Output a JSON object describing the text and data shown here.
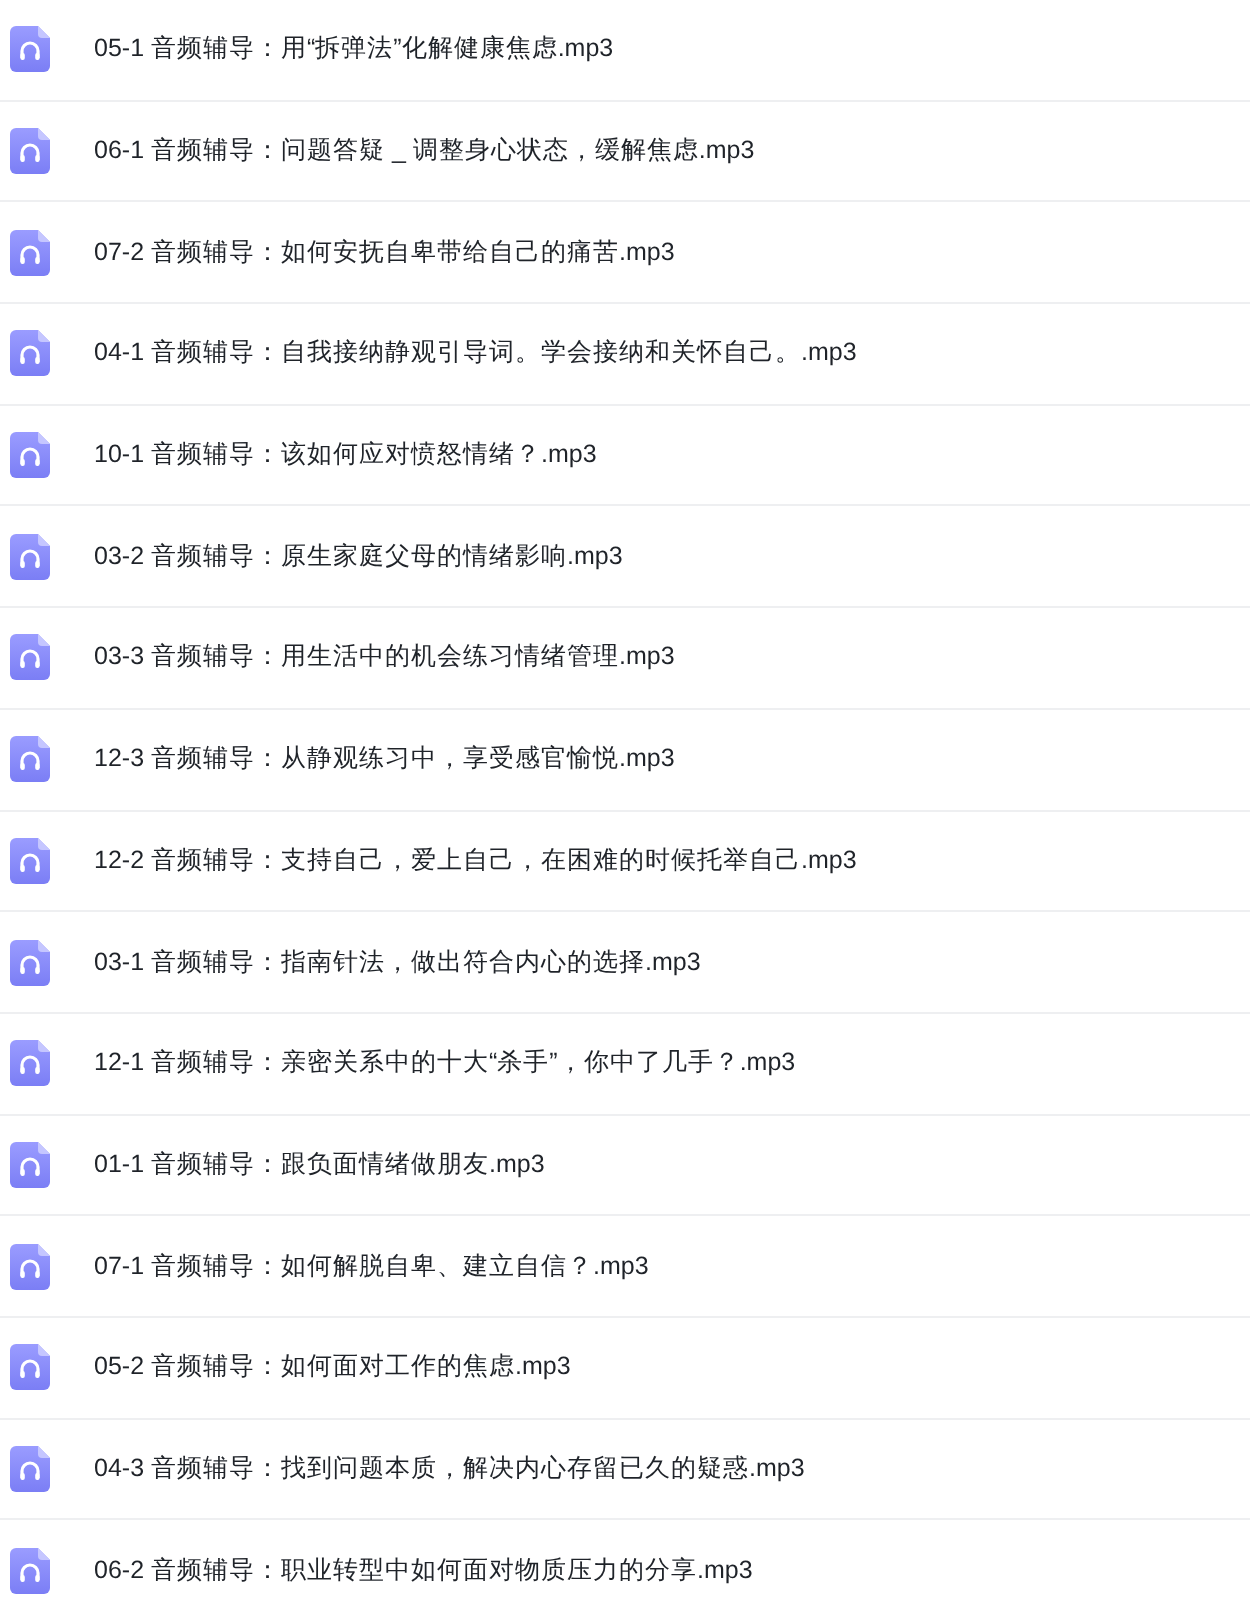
{
  "files": [
    {
      "name": "05-1 音频辅导：用“拆弹法”化解健康焦虑.mp3"
    },
    {
      "name": "06-1 音频辅导：问题答疑 _ 调整身心状态，缓解焦虑.mp3"
    },
    {
      "name": "07-2 音频辅导：如何安抚自卑带给自己的痛苦.mp3"
    },
    {
      "name": "04-1 音频辅导：自我接纳静观引导词。学会接纳和关怀自己。.mp3"
    },
    {
      "name": "10-1 音频辅导：该如何应对愤怒情绪？.mp3"
    },
    {
      "name": "03-2 音频辅导：原生家庭父母的情绪影响.mp3"
    },
    {
      "name": "03-3 音频辅导：用生活中的机会练习情绪管理.mp3"
    },
    {
      "name": "12-3 音频辅导：从静观练习中，享受感官愉悦.mp3"
    },
    {
      "name": "12-2 音频辅导：支持自己，爱上自己，在困难的时候托举自己.mp3"
    },
    {
      "name": "03-1 音频辅导：指南针法，做出符合内心的选择.mp3"
    },
    {
      "name": "12-1 音频辅导：亲密关系中的十大“杀手”，你中了几手？.mp3"
    },
    {
      "name": "01-1 音频辅导：跟负面情绪做朋友.mp3"
    },
    {
      "name": "07-1 音频辅导：如何解脱自卑、建立自信？.mp3"
    },
    {
      "name": "05-2 音频辅导：如何面对工作的焦虑.mp3"
    },
    {
      "name": "04-3 音频辅导：找到问题本质，解决内心存留已久的疑惑.mp3"
    },
    {
      "name": "06-2 音频辅导：职业转型中如何面对物质压力的分享.mp3"
    }
  ]
}
